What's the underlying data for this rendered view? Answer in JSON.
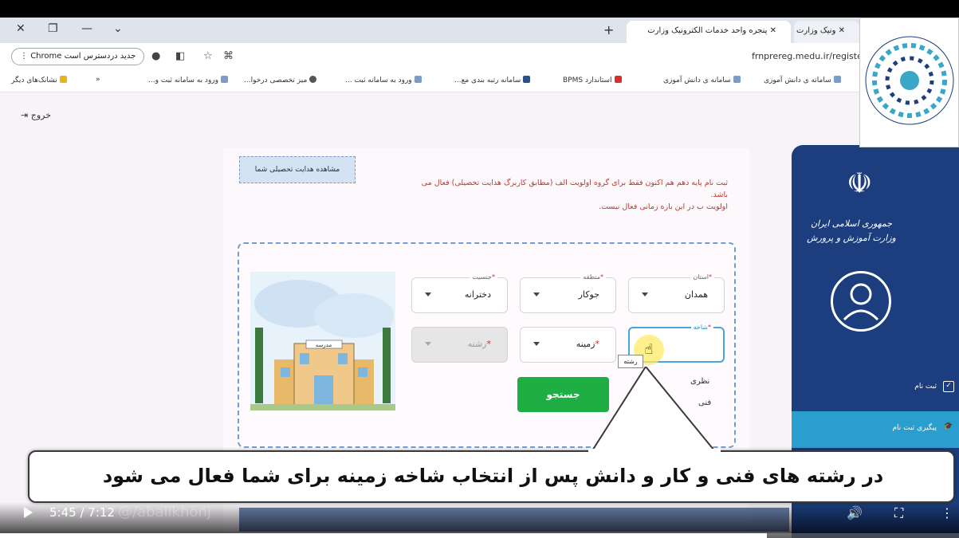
{
  "browser": {
    "tabs": [
      {
        "title": "ونیک وزارت",
        "active": false
      },
      {
        "title": "پنجره واحد خدمات الکترونیک وزارت",
        "active": true
      }
    ],
    "new_tab": "+",
    "chrome_pill": "Chrome جدید دردسترس است",
    "url": "frnprereg.medu.ir/registe",
    "bookmarks": [
      "سامانه ی دانش آموزی",
      "سامانه ی دانش آموزی",
      "استاندارد BPMS",
      "سامانه رتبه بندی مع...",
      "ورود به سامانه ثبت ...",
      "میز تخصصی درخوا...",
      "ورود به سامانه ثبت و...",
      "نشانک‌های دیگر"
    ]
  },
  "page": {
    "exit_label": "خروج",
    "notice_lines": [
      "ثبت نام پایه دهم هم اکنون فقط برای گروه اولویت الف (مطابق کاربرگ هدایت تحصیلی) فعال می",
      "باشد.",
      "اولویت ب در این بازه زمانی فعال نیست."
    ],
    "guide_button": "مشاهده هدایت تحصیلی شما",
    "fields": {
      "province": {
        "label": "استان",
        "value": "همدان"
      },
      "region": {
        "label": "منطقه",
        "value": "جوکار"
      },
      "gender": {
        "label": "جنسیت",
        "value": "دخترانه"
      },
      "branch": {
        "label": "شاخه",
        "value": ""
      },
      "field": {
        "label": "",
        "value": "زمینه"
      },
      "major": {
        "label": "",
        "value": "رشته"
      }
    },
    "tooltip": "رشته",
    "options": [
      "نظری",
      "فنی"
    ],
    "search_button": "جستجو",
    "illustration_sign": "مدرسه"
  },
  "sidebar": {
    "title_line1": "جمهوری اسلامی ایران",
    "title_line2": "وزارت آموزش و پرورش",
    "items": [
      {
        "label": "ثبت نام",
        "highlight": false
      },
      {
        "label": "پیگیری ثبت نام",
        "highlight": true
      }
    ]
  },
  "caption": "در رشته های فنی و کار و دانش پس از انتخاب شاخه زمینه برای شما فعال می شود",
  "player": {
    "time": "5:45 / 7:12",
    "watermark": "@/abalikhonj",
    "progress_fraction": 0.8
  },
  "colors": {
    "sidebar": "#1c3e7e",
    "search_button": "#1fae43",
    "notice": "#c0392b",
    "dashed_border": "#6f9ed0"
  }
}
